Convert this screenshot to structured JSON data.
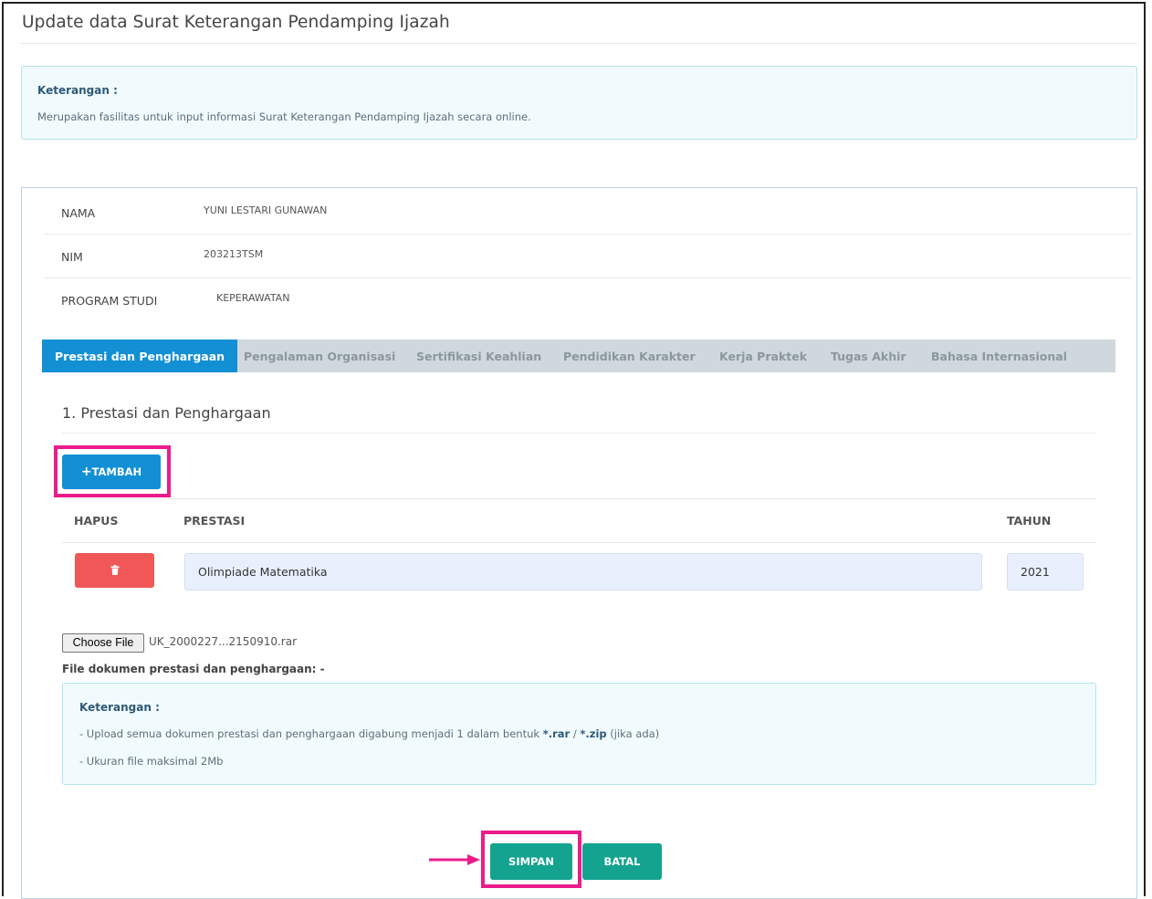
{
  "page": {
    "title": "Update data Surat Keterangan Pendamping Ijazah"
  },
  "info_top": {
    "title": "Keterangan :",
    "text": "Merupakan fasilitas untuk input informasi Surat Keterangan Pendamping Ijazah secara online."
  },
  "student": {
    "rows": [
      {
        "label": "NAMA",
        "value": "YUNI LESTARI GUNAWAN"
      },
      {
        "label": "NIM",
        "value": "203213TSM"
      },
      {
        "label": "PROGRAM STUDI",
        "value": "KEPERAWATAN"
      }
    ]
  },
  "tabs": [
    {
      "label": "Prestasi dan Penghargaan",
      "active": true
    },
    {
      "label": "Pengalaman Organisasi",
      "active": false
    },
    {
      "label": "Sertifikasi Keahlian",
      "active": false
    },
    {
      "label": "Pendidikan Karakter",
      "active": false
    },
    {
      "label": "Kerja Praktek",
      "active": false
    },
    {
      "label": "Tugas Akhir",
      "active": false
    },
    {
      "label": "Bahasa Internasional",
      "active": false
    }
  ],
  "section": {
    "title": "1. Prestasi dan Penghargaan",
    "add_button": "TAMBAH",
    "columns": {
      "hapus": "HAPUS",
      "prestasi": "PRESTASI",
      "tahun": "TAHUN"
    },
    "rows": [
      {
        "prestasi": "Olimpiade Matematika",
        "tahun": "2021"
      }
    ]
  },
  "upload": {
    "choose_label": "Choose File",
    "file_name": "UK_2000227...2150910.rar",
    "doc_label": "File dokumen prestasi dan penghargaan: -"
  },
  "info_bottom": {
    "title": "Keterangan :",
    "line1_pre": "- Upload semua dokumen prestasi dan penghargaan digabung menjadi 1 dalam bentuk ",
    "ext_rar": "*.rar",
    "sep": " / ",
    "ext_zip": "*.zip",
    "line1_post": " (jika ada)",
    "line2": "- Ukuran file maksimal 2Mb"
  },
  "actions": {
    "save": "SIMPAN",
    "cancel": "BATAL"
  },
  "colors": {
    "primary": "#1390d4",
    "danger": "#ef5856",
    "success": "#13a38f",
    "highlight": "#ec1b8c"
  }
}
